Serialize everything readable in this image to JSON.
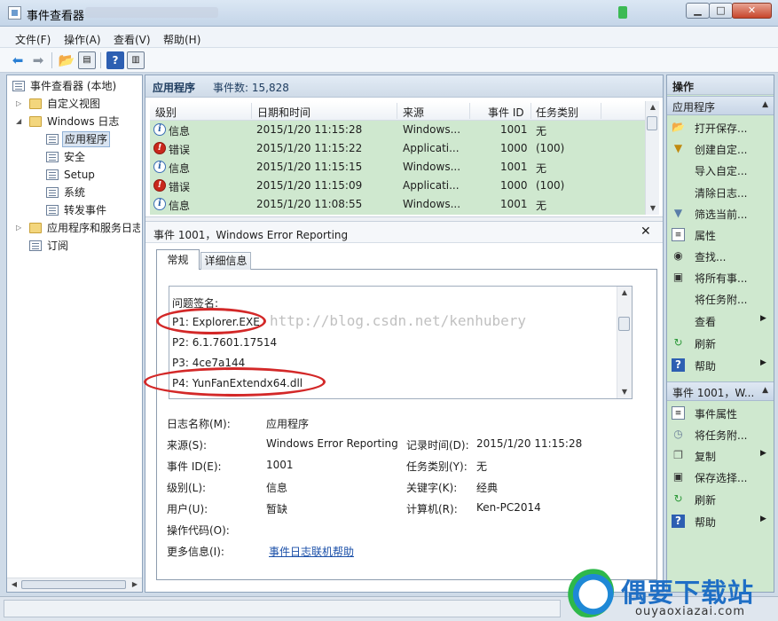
{
  "window": {
    "title": "事件查看器"
  },
  "menu": [
    "文件(F)",
    "操作(A)",
    "查看(V)",
    "帮助(H)"
  ],
  "tree": {
    "root": "事件查看器 (本地)",
    "custom_views": "自定义视图",
    "windows_logs": "Windows 日志",
    "logs": [
      "应用程序",
      "安全",
      "Setup",
      "系统",
      "转发事件"
    ],
    "app_service_logs": "应用程序和服务日志",
    "subscriptions": "订阅"
  },
  "center": {
    "log_name": "应用程序",
    "event_count": "事件数: 15,828",
    "columns": [
      "级别",
      "日期和时间",
      "来源",
      "事件 ID",
      "任务类别"
    ],
    "rows": [
      {
        "level": "信息",
        "level_type": "info",
        "datetime": "2015/1/20 11:15:28",
        "source": "Windows...",
        "event_id": "1001",
        "category": "无"
      },
      {
        "level": "错误",
        "level_type": "error",
        "datetime": "2015/1/20 11:15:22",
        "source": "Applicati...",
        "event_id": "1000",
        "category": "(100)"
      },
      {
        "level": "信息",
        "level_type": "info",
        "datetime": "2015/1/20 11:15:15",
        "source": "Windows...",
        "event_id": "1001",
        "category": "无"
      },
      {
        "level": "错误",
        "level_type": "error",
        "datetime": "2015/1/20 11:15:09",
        "source": "Applicati...",
        "event_id": "1000",
        "category": "(100)"
      },
      {
        "level": "信息",
        "level_type": "info",
        "datetime": "2015/1/20 11:08:55",
        "source": "Windows...",
        "event_id": "1001",
        "category": "无"
      }
    ]
  },
  "detail": {
    "title": "事件 1001，Windows Error Reporting",
    "tabs": [
      "常规",
      "详细信息"
    ],
    "message_lines": [
      "问题签名:",
      "P1: Explorer.EXE",
      "P2: 6.1.7601.17514",
      "P3: 4ce7a144",
      "P4: YunFanExtendx64.dll"
    ],
    "watermark_url": "http://blog.csdn.net/kenhubery",
    "props": {
      "log_name_label": "日志名称(M):",
      "log_name": "应用程序",
      "source_label": "来源(S):",
      "source": "Windows Error Reporting",
      "logged_label": "记录时间(D):",
      "logged": "2015/1/20 11:15:28",
      "event_id_label": "事件 ID(E):",
      "event_id": "1001",
      "task_label": "任务类别(Y):",
      "task": "无",
      "level_label": "级别(L):",
      "level": "信息",
      "keywords_label": "关键字(K):",
      "keywords": "经典",
      "user_label": "用户(U):",
      "user": "暂缺",
      "computer_label": "计算机(R):",
      "computer": "Ken-PC2014",
      "opcode_label": "操作代码(O):",
      "more_info_label": "更多信息(I):",
      "more_info_link": "事件日志联机帮助"
    }
  },
  "actions": {
    "title": "操作",
    "group1": "应用程序",
    "group1_items": [
      "打开保存...",
      "创建自定...",
      "导入自定...",
      "清除日志...",
      "筛选当前...",
      "属性",
      "查找...",
      "将所有事...",
      "将任务附...",
      "查看",
      "刷新",
      "帮助"
    ],
    "group2": "事件 1001，W...",
    "group2_items": [
      "事件属性",
      "将任务附...",
      "复制",
      "保存选择...",
      "刷新",
      "帮助"
    ]
  },
  "watermark": {
    "logo_text": "偶要下载站",
    "logo_sub": "ouyaoxiazai.com"
  },
  "colors": {
    "row_highlight": "#cfe8cf",
    "annotation_red": "#d32828",
    "error_red": "#c9281c",
    "info_blue": "#3a6fb5"
  }
}
